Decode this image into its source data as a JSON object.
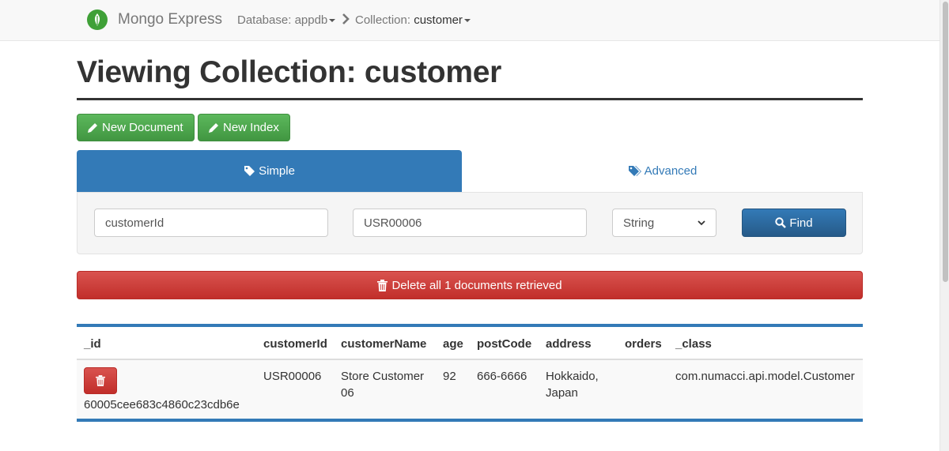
{
  "navbar": {
    "brand": "Mongo Express",
    "database_label": "Database:",
    "database_value": "appdb",
    "collection_label": "Collection:",
    "collection_value": "customer"
  },
  "page": {
    "title": "Viewing Collection: customer"
  },
  "actions": {
    "new_document": "New Document",
    "new_index": "New Index"
  },
  "tabs": {
    "simple": "Simple",
    "advanced": "Advanced"
  },
  "search": {
    "key": "customerId",
    "value": "USR00006",
    "type_selected": "String",
    "find_label": "Find"
  },
  "delete_all_label": "Delete all 1 documents retrieved",
  "table": {
    "columns": [
      "_id",
      "customerId",
      "customerName",
      "age",
      "postCode",
      "address",
      "orders",
      "_class"
    ],
    "rows": [
      {
        "_id": "60005cee683c4860c23cdb6e",
        "customerId": "USR00006",
        "customerName_line1": "Store Customer",
        "customerName_line2": "06",
        "age": "92",
        "postCode": "666-6666",
        "address_line1": "Hokkaido,",
        "address_line2": "Japan",
        "orders": "",
        "_class": "com.numacci.api.model.Customer"
      }
    ]
  },
  "colors": {
    "primary": "#337ab7",
    "success": "#5cb85c",
    "danger": "#d9534f",
    "brand_green": "#3fa037"
  }
}
